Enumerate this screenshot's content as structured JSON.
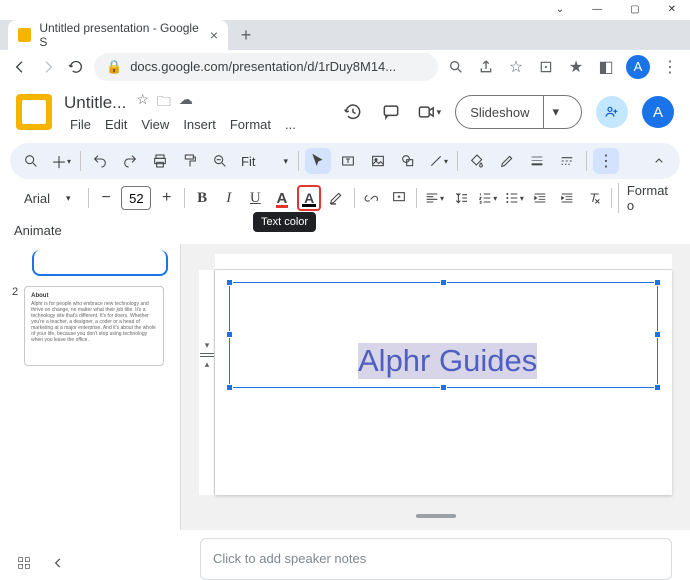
{
  "browser": {
    "tab_title": "Untitled presentation - Google S",
    "url": "docs.google.com/presentation/d/1rDuy8M14...",
    "avatar_letter": "A"
  },
  "header": {
    "doc_title": "Untitle...",
    "menus": [
      "File",
      "Edit",
      "View",
      "Insert",
      "Format",
      "..."
    ],
    "slideshow_label": "Slideshow",
    "account_letter": "A"
  },
  "toolbar1": {
    "zoom_label": "Fit"
  },
  "toolbar2": {
    "font_name": "Arial",
    "font_size": "52",
    "tooltip_text_color": "Text color",
    "format_more": "Format o"
  },
  "sidebar": {
    "animate_label": "Animate",
    "slide2_num": "2",
    "slide2_heading": "About",
    "slide2_body": "Alphr is for people who embrace new technology and thrive on change, no matter what their job title. It's a technology site that's different. It's for doers. Whether you're a teacher, a designer, a coder or a head of marketing at a major enterprise. And it's about the whole of your life, because you don't stop using technology when you leave the office."
  },
  "canvas": {
    "text_content": "Alphr Guides"
  },
  "notes": {
    "placeholder": "Click to add speaker notes"
  }
}
